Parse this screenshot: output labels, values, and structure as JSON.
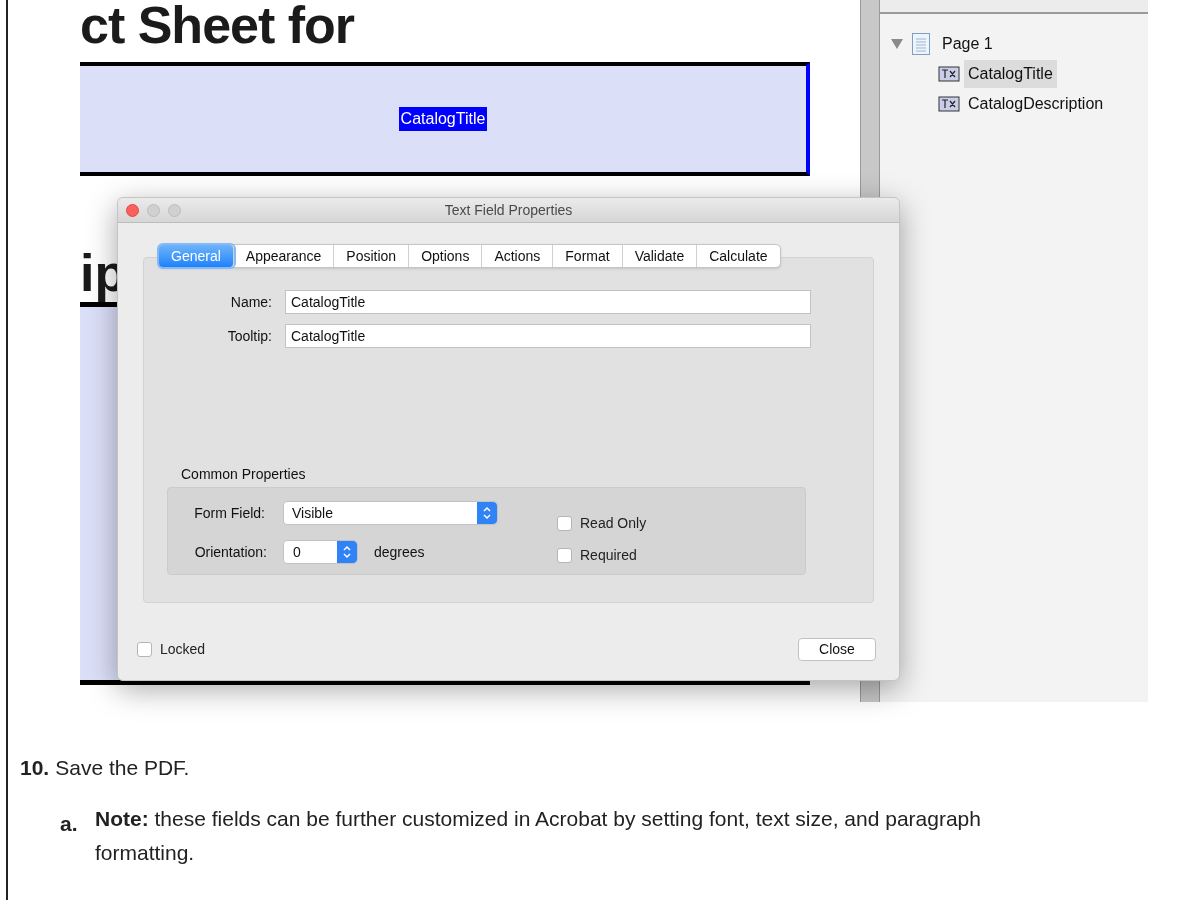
{
  "document": {
    "heading": "ct Sheet for",
    "selected_field": "CatalogTitle",
    "heading_2": "ip"
  },
  "fields_panel": {
    "tree": [
      {
        "label": "Page 1",
        "expanded": true,
        "selected": false,
        "children": [
          {
            "label": "CatalogTitle",
            "selected": true
          },
          {
            "label": "CatalogDescription",
            "selected": false
          }
        ]
      }
    ]
  },
  "dialog": {
    "title": "Text Field Properties",
    "tabs": [
      {
        "label": "General",
        "selected": true
      },
      {
        "label": "Appearance",
        "selected": false
      },
      {
        "label": "Position",
        "selected": false
      },
      {
        "label": "Options",
        "selected": false
      },
      {
        "label": "Actions",
        "selected": false
      },
      {
        "label": "Format",
        "selected": false
      },
      {
        "label": "Validate",
        "selected": false
      },
      {
        "label": "Calculate",
        "selected": false
      }
    ],
    "fields": [
      {
        "label": "Name:",
        "value": "CatalogTitle"
      },
      {
        "label": "Tooltip:",
        "value": "CatalogTitle"
      }
    ],
    "common_properties": {
      "title": "Common Properties",
      "form_field": {
        "label": "Form Field:",
        "value": "Visible"
      },
      "orientation": {
        "label": "Orientation:",
        "value": "0",
        "unit": "degrees"
      },
      "checkboxes": [
        {
          "label": "Read Only",
          "checked": false
        },
        {
          "label": "Required",
          "checked": false
        }
      ]
    },
    "locked": {
      "label": "Locked",
      "checked": false
    },
    "close_button": "Close"
  },
  "steps": [
    {
      "number": "10.",
      "text": "Save the PDF.",
      "substeps": [
        {
          "marker": "a.",
          "text": "**Note:** these fields can be further customized in Acrobat by setting font, text size, and paragraph formatting."
        }
      ]
    }
  ]
}
